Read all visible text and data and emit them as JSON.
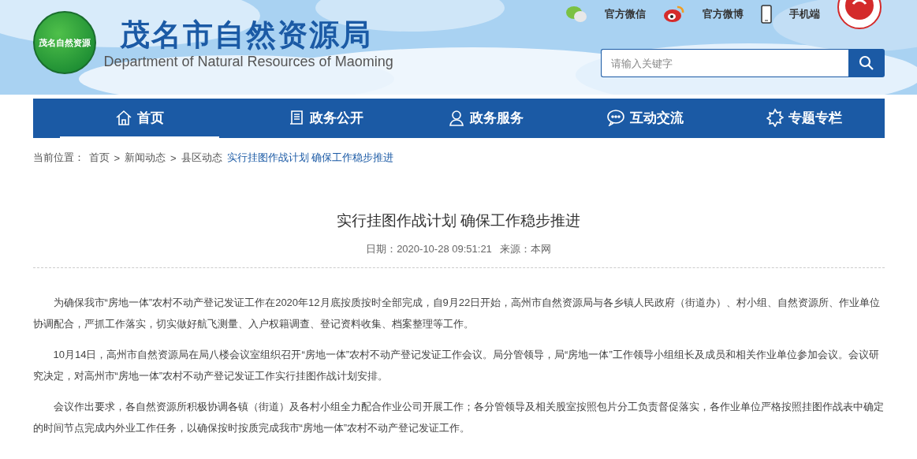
{
  "header": {
    "logo_badge": "茂名自然资源",
    "title": "茂名市自然资源局",
    "subtitle": "Department of Natural Resources of Maoming",
    "links": [
      {
        "kind": "wechat",
        "label": "官方微信"
      },
      {
        "kind": "weibo",
        "label": "官方微博"
      },
      {
        "kind": "mobile",
        "label": "手机端"
      }
    ],
    "search": {
      "placeholder": "请输入关键字"
    }
  },
  "nav": [
    {
      "kind": "home",
      "label": "首页",
      "selected": true
    },
    {
      "kind": "doc",
      "label": "政务公开",
      "selected": false
    },
    {
      "kind": "service",
      "label": "政务服务",
      "selected": false
    },
    {
      "kind": "chat",
      "label": "互动交流",
      "selected": false
    },
    {
      "kind": "award",
      "label": "专题专栏",
      "selected": false
    }
  ],
  "breadcrumb": {
    "label": "当前位置：",
    "separator": ">",
    "items": [
      "首页",
      "新闻动态",
      "县区动态"
    ],
    "current": "实行挂图作战计划 确保工作稳步推进"
  },
  "article": {
    "title": "实行挂图作战计划 确保工作稳步推进",
    "date": "日期：2020-10-28 09:51:21",
    "source": "来源：本网",
    "paragraphs": [
      "为确保我市“房地一体”农村不动产登记发证工作在2020年12月底按质按时全部完成，自9月22日开始，高州市自然资源局与各乡镇人民政府（街道办）、村小组、自然资源所、作业单位协调配合，严抓工作落实，切实做好航飞测量、入户权籍调查、登记资料收集、档案整理等工作。",
      "10月14日，高州市自然资源局在局八楼会议室组织召开“房地一体”农村不动产登记发证工作会议。局分管领导，局“房地一体”工作领导小组组长及成员和相关作业单位参加会议。会议研究决定，对高州市“房地一体”农村不动产登记发证工作实行挂图作战计划安排。",
      "会议作出要求，各自然资源所积极协调各镇（街道）及各村小组全力配合作业公司开展工作；各分管领导及相关股室按照包片分工负责督促落实，各作业单位严格按照挂图作战表中确定的时间节点完成内外业工作任务，以确保按时按质完成我市“房地一体”农村不动产登记发证工作。"
    ]
  }
}
